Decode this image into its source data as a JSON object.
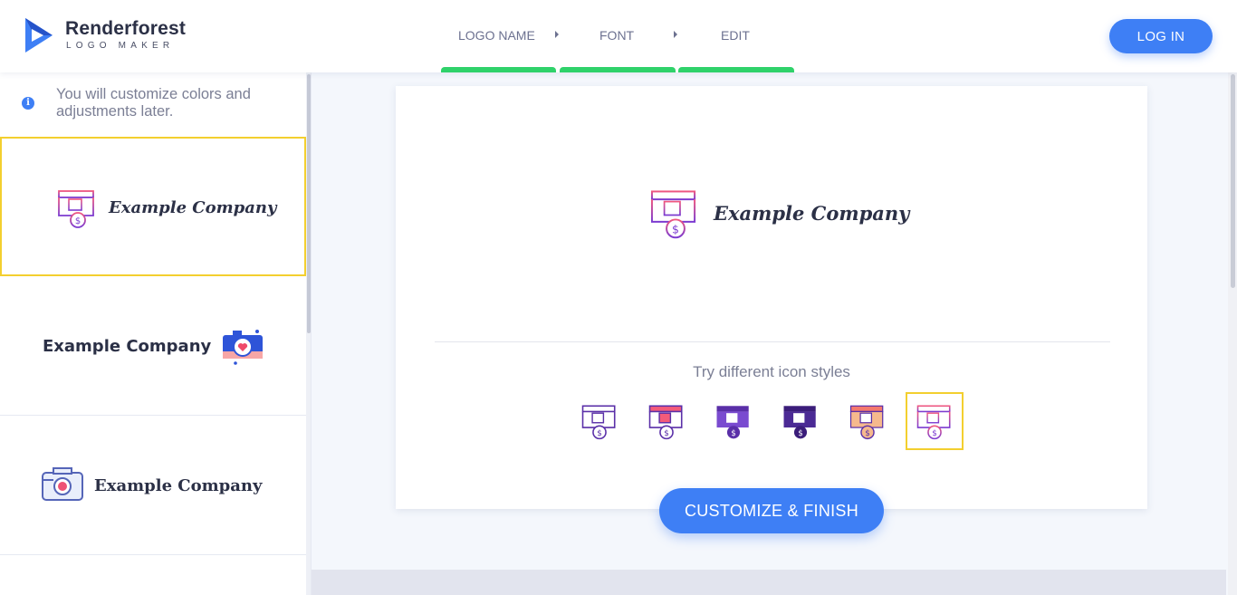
{
  "brand": {
    "name": "Renderforest",
    "subtitle": "LOGO MAKER"
  },
  "steps": [
    {
      "label": "LOGO NAME"
    },
    {
      "label": "FONT"
    },
    {
      "label": "EDIT"
    }
  ],
  "login_label": "LOG IN",
  "sidebar": {
    "info_text": "You will customize colors and adjustments later.",
    "cards": [
      {
        "company": "Example Company",
        "icon": "shop-icon"
      },
      {
        "company": "Example Company",
        "icon": "camera-heart-icon"
      },
      {
        "company": "Example Company",
        "icon": "camera-icon"
      }
    ]
  },
  "preview": {
    "company": "Example Company",
    "icon": "shop-icon",
    "try_label": "Try different icon styles",
    "style_options": [
      "shop-icon-outline",
      "shop-icon-red-accent",
      "shop-icon-purple-filled",
      "shop-icon-dark-filled",
      "shop-icon-orange-filled",
      "shop-icon-gradient"
    ],
    "selected_style_index": 5
  },
  "customize_label": "CUSTOMIZE & FINISH",
  "colors": {
    "accent_blue": "#3e7ff5",
    "step_green": "#2fd26a",
    "selection_yellow": "#f3cf2f",
    "text_dark": "#2b3046"
  }
}
